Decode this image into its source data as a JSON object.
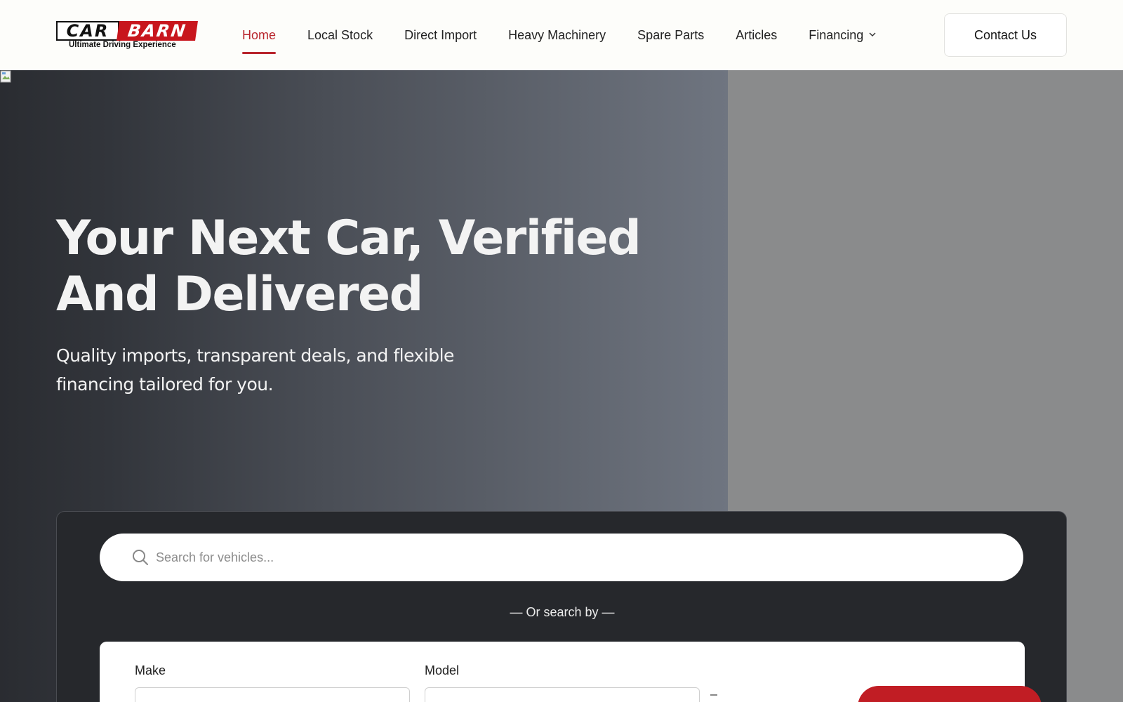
{
  "header": {
    "logo": {
      "word_car": "CAR",
      "word_barn": "BARN",
      "tagline": "Ultimate Driving Experience"
    },
    "nav": [
      {
        "label": "Home",
        "active": true
      },
      {
        "label": "Local Stock",
        "active": false
      },
      {
        "label": "Direct Import",
        "active": false
      },
      {
        "label": "Heavy Machinery",
        "active": false
      },
      {
        "label": "Spare Parts",
        "active": false
      },
      {
        "label": "Articles",
        "active": false
      },
      {
        "label": "Financing",
        "active": false,
        "has_dropdown": true
      }
    ],
    "contact_label": "Contact Us"
  },
  "hero": {
    "title_line1": "Your Next Car, Verified",
    "title_line2": "And Delivered",
    "subtitle_line1": "Quality imports, transparent deals, and flexible",
    "subtitle_line2": "financing tailored for you."
  },
  "search": {
    "placeholder": "Search for vehicles...",
    "or_search_by": "— Or search by —",
    "filters": {
      "make_label": "Make",
      "model_label": "Model"
    }
  },
  "colors": {
    "accent": "#b8252c",
    "button_red": "#c11d24",
    "header_bg": "#fdfdfa",
    "panel_bg": "#26282c"
  },
  "icons": [
    "search-icon",
    "chevron-down-icon",
    "broken-image-icon"
  ]
}
